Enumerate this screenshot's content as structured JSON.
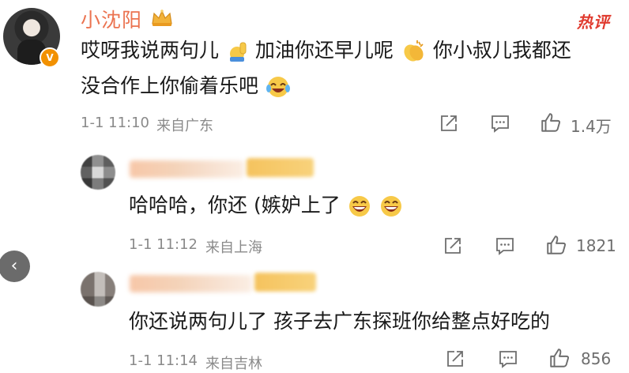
{
  "comment": {
    "username": "小沈阳",
    "hot_label": "热评",
    "verified_badge": "V",
    "text_line1_a": "哎呀我说两句儿",
    "text_line1_b": "加油你还早儿呢",
    "text_line1_c": "你小叔儿我都还",
    "text_line2": "没合作上你偷着乐吧",
    "time": "1-1 11:10",
    "location": "来自广东",
    "like_count": "1.4万"
  },
  "replies": [
    {
      "text": "哈哈哈，你还 (嫉妒上了",
      "time": "1-1 11:12",
      "location": "来自上海",
      "like_count": "1821"
    },
    {
      "text": "你还说两句儿了 孩子去广东探班你给整点好吃的",
      "time": "1-1 11:14",
      "location": "来自吉林",
      "like_count": "856"
    }
  ],
  "nav": {
    "back_glyph": "‹"
  },
  "colors": {
    "username": "#eb7350",
    "hot": "#e03b2f",
    "meta": "#8a8a8a",
    "verified": "#f29100"
  },
  "icons": [
    "crown-icon",
    "raise-hand-emoji-icon",
    "clap-emoji-icon",
    "laugh-cry-emoji-icon",
    "grin-emoji-icon",
    "share-icon",
    "comment-icon",
    "like-icon",
    "chevron-left-icon"
  ]
}
